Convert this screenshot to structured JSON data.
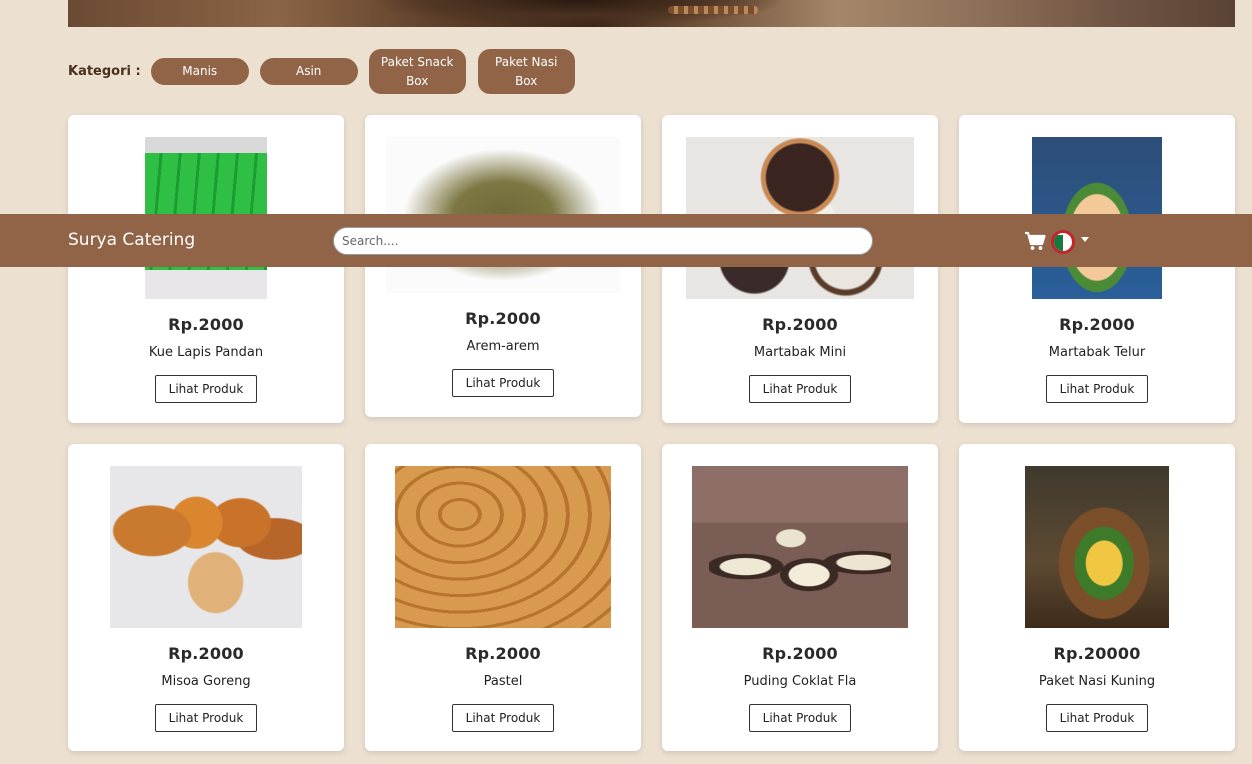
{
  "app": {
    "brand": "Surya Catering"
  },
  "search": {
    "placeholder": "Search...."
  },
  "categories": {
    "label": "Kategori :",
    "items": [
      "Manis",
      "Asin",
      "Paket Snack Box",
      "Paket Nasi Box"
    ]
  },
  "products": [
    {
      "price": "Rp.2000",
      "name": "Kue Lapis Pandan",
      "button": "Lihat Produk"
    },
    {
      "price": "Rp.2000",
      "name": "Arem-arem",
      "button": "Lihat Produk"
    },
    {
      "price": "Rp.2000",
      "name": "Martabak Mini",
      "button": "Lihat Produk"
    },
    {
      "price": "Rp.2000",
      "name": "Martabak Telur",
      "button": "Lihat Produk"
    },
    {
      "price": "Rp.2000",
      "name": "Misoa Goreng",
      "button": "Lihat Produk"
    },
    {
      "price": "Rp.2000",
      "name": "Pastel",
      "button": "Lihat Produk"
    },
    {
      "price": "Rp.2000",
      "name": "Puding Coklat Fla",
      "button": "Lihat Produk"
    },
    {
      "price": "Rp.20000",
      "name": "Paket Nasi Kuning",
      "button": "Lihat Produk"
    }
  ],
  "icons": {
    "cart": "cart-icon",
    "language": "flag-icon",
    "dropdown": "caret-down-icon"
  },
  "colors": {
    "accent": "#916447",
    "background": "#ece0d1"
  }
}
